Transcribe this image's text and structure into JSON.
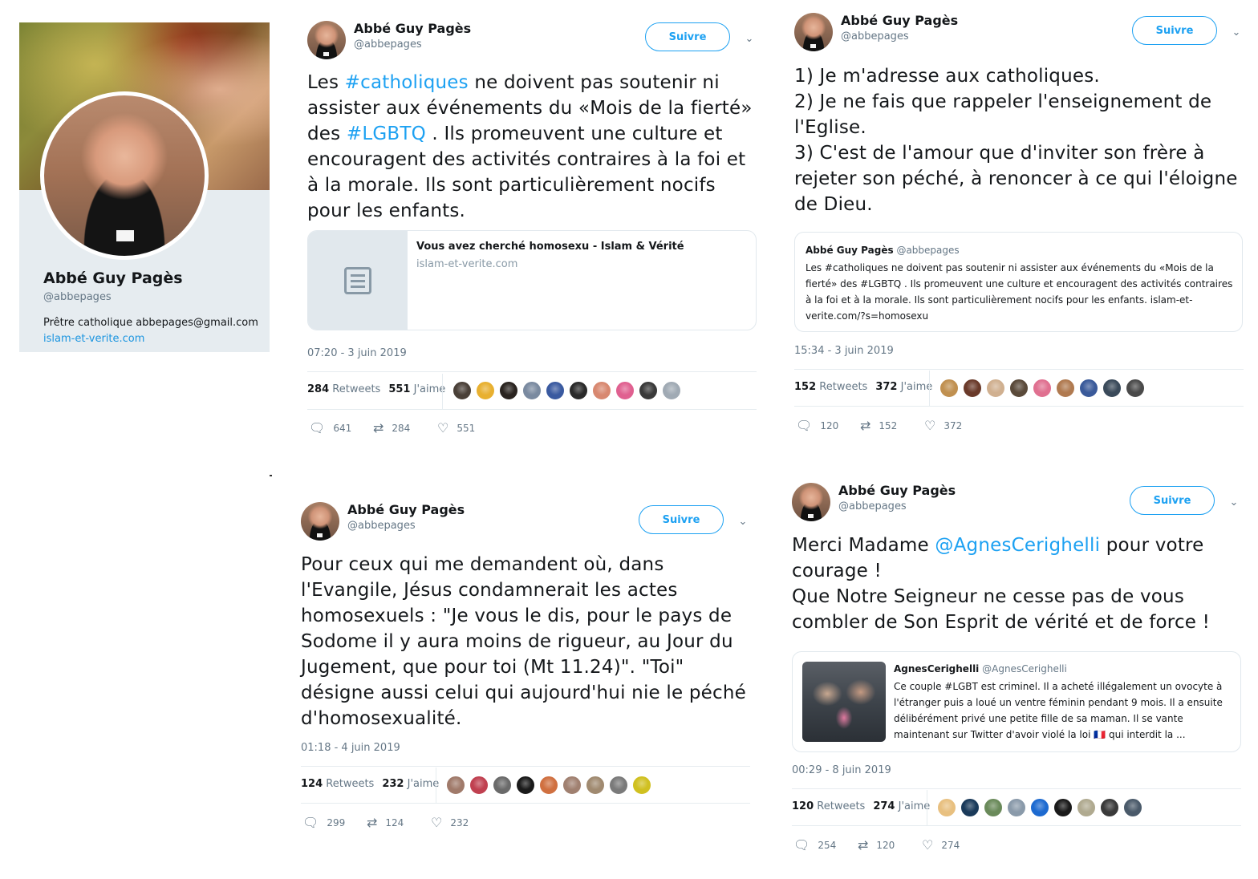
{
  "profile": {
    "name": "Abbé Guy Pagès",
    "handle": "@abbepages",
    "bio": "Prêtre catholique abbepages@gmail.com",
    "link": "islam-et-verite.com"
  },
  "common": {
    "follow_label": "Suivre",
    "retweets_label": "Retweets",
    "likes_label": "J'aime"
  },
  "tweets": [
    {
      "name": "Abbé Guy Pagès",
      "handle": "@abbepages",
      "text_parts": [
        "Les ",
        "#catholiques",
        " ne doivent pas soutenir ni assister aux événements du «Mois de la fierté» des ",
        "#LGBTQ",
        " . Ils promeuvent une culture et encouragent des activités contraires à la foi et à la morale. Ils sont particulièrement nocifs pour les enfants."
      ],
      "card": {
        "title": "Vous avez cherché homosexu - Islam & Vérité",
        "domain": "islam-et-verite.com"
      },
      "time": "07:20 - 3 juin 2019",
      "retweets": "284",
      "likes": "551",
      "replies": "641"
    },
    {
      "name": "Abbé Guy Pagès",
      "handle": "@abbepages",
      "text": "1) Je m'adresse aux catholiques.\n2) Je ne fais que rappeler l'enseignement de l'Eglise.\n3) C'est de l'amour que d'inviter son frère à rejeter son péché, à renoncer à ce qui l'éloigne de Dieu.",
      "quote": {
        "name": "Abbé Guy Pagès",
        "handle": "@abbepages",
        "text": "Les #catholiques ne doivent pas soutenir ni assister aux événements du «Mois de la fierté» des #LGBTQ . Ils promeuvent une culture et encouragent des activités contraires à la foi et à la morale. Ils sont particulièrement nocifs pour les enfants. islam-et-verite.com/?s=homosexu"
      },
      "time": "15:34 - 3 juin 2019",
      "retweets": "152",
      "likes": "372",
      "replies": "120"
    },
    {
      "name": "Abbé Guy Pagès",
      "handle": "@abbepages",
      "text": "Pour ceux qui me demandent où, dans l'Evangile, Jésus condamnerait les actes homosexuels : \"Je vous le dis, pour le pays de Sodome il y aura moins de rigueur, au Jour du Jugement, que pour toi (Mt 11.24)\". \"Toi\" désigne aussi celui qui aujourd'hui nie le péché d'homosexualité.",
      "time": "01:18 - 4 juin 2019",
      "retweets": "124",
      "likes": "232",
      "replies": "299"
    },
    {
      "name": "Abbé Guy Pagès",
      "handle": "@abbepages",
      "text_parts": [
        "Merci Madame ",
        "@AgnesCerighelli",
        " pour votre courage !\nQue Notre Seigneur ne cesse pas de vous combler de Son Esprit de vérité et de force !"
      ],
      "quote": {
        "name": "AgnesCerighelli",
        "handle": "@AgnesCerighelli",
        "text": "Ce couple #LGBT est criminel. Il a acheté illégalement un ovocyte à l'étranger puis a loué un ventre féminin pendant 9 mois. Il a ensuite délibérément privé une petite fille de sa maman. Il se vante maintenant sur Twitter d'avoir violé la loi 🇫🇷 qui interdit la ..."
      },
      "time": "00:29 - 8 juin 2019",
      "retweets": "120",
      "likes": "274",
      "replies": "254"
    }
  ],
  "icons": {
    "reply": "reply-icon",
    "retweet": "retweet-icon",
    "like": "heart-icon",
    "chevron": "chevron-down-icon",
    "doc": "document-icon"
  },
  "colors": {
    "accent": "#1da1f2",
    "link": "#1b95e0",
    "muted": "#657786",
    "card_bg": "#e6ecf0"
  },
  "liker_colors": [
    [
      "#4a4038",
      "#e8b030",
      "#2a2420",
      "#7a8aa0",
      "#3a5aa0",
      "#2a2a2a",
      "#d88870",
      "#e06090",
      "#3a3a3a",
      "#a0aab4"
    ],
    [
      "#c09050",
      "#6a3a2a",
      "#d0b090",
      "#5a4a3a",
      "#e07090",
      "#b07a50",
      "#3a5a9a",
      "#3a4a5a",
      "#4a4a4a"
    ],
    [
      "#a07a6a",
      "#c04050",
      "#6a6a6a",
      "#1a1a1a",
      "#d07040",
      "#a08070",
      "#a08a70",
      "#7a7a7a",
      "#d0c020"
    ],
    [
      "#e8c080",
      "#1a3a5a",
      "#6a8a5a",
      "#8a9aaa",
      "#1d6ad0",
      "#1a1a1a",
      "#b0aa90",
      "#3a3a3a",
      "#4a5a6a"
    ]
  ]
}
